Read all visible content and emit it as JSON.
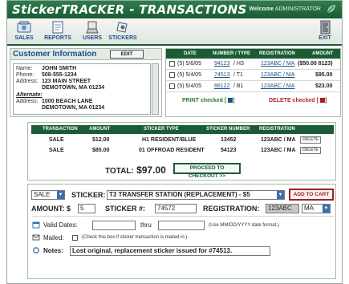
{
  "app": {
    "title": "StickerTRACKER",
    "title_sep": " - ",
    "section": "TRANSACTIONS",
    "welcome_label": "Welcome",
    "user": "ADMINISTRATOR"
  },
  "toolbar": {
    "items": [
      {
        "label": "SALES",
        "icon": "sales-icon"
      },
      {
        "label": "REPORTS",
        "icon": "reports-icon"
      },
      {
        "label": "USERS",
        "icon": "users-icon"
      },
      {
        "label": "STICKERS",
        "icon": "stickers-icon"
      }
    ],
    "exit_label": "EXIT"
  },
  "customer": {
    "heading": "Customer Information",
    "edit_label": "EDIT",
    "name_label": "Name:",
    "name": "JOHN SMITH",
    "phone_label": "Phone:",
    "phone": "508-555-1234",
    "address_label": "Address:",
    "address_line1": "123 MAIN STREET",
    "address_line2": "DEMOTOWN, MA 01234",
    "alternate_label": "Alternate:",
    "alt_address_label": "Address:",
    "alt_line1": "1000 BEACH LANE",
    "alt_line2": "DEMOTOWN, MA 01234"
  },
  "history": {
    "columns": [
      "DATE",
      "NUMBER / TYPE",
      "REGISTRATION",
      "AMOUNT"
    ],
    "rows": [
      {
        "date": "(5) 5/6/05",
        "number": "94123",
        "type": "/ H3",
        "registration": "123ABC / MA",
        "amount": "($50.00 8123)"
      },
      {
        "date": "(5) 5/4/05",
        "number": "74513",
        "type": "/ T1",
        "registration": "123ABC / MA",
        "amount": "$95.00"
      },
      {
        "date": "(5) 5/4/05",
        "number": "86122",
        "type": "/ B1",
        "registration": "123ABC / MA",
        "amount": "$23.00"
      }
    ],
    "print_label": "PRINT checked [",
    "print_suffix": "]",
    "delete_label": "DELETE checked [",
    "delete_suffix": "]"
  },
  "transactions": {
    "columns": [
      "TRANSACTION",
      "AMOUNT",
      "STICKER TYPE",
      "STICKER NUMBER",
      "REGISTRATION"
    ],
    "rows": [
      {
        "transaction": "SALE",
        "amount": "$12.00",
        "sticker_type": "H1 RESIDENT/BLUE",
        "sticker_number": "13452",
        "registration": "123ABC / MA",
        "delete": "DELETE"
      },
      {
        "transaction": "SALE",
        "amount": "$85.00",
        "sticker_type": "01 OFFROAD RESIDENT",
        "sticker_number": "54123",
        "registration": "123ABC / MA",
        "delete": "DELETE"
      }
    ],
    "total_label": "TOTAL:",
    "total_value": "$97.00",
    "checkout_label": "PROCEED TO CHECKOUT >>"
  },
  "entry": {
    "transaction_type": "SALE",
    "sticker_label": "STICKER:",
    "sticker_value": "T3 TRANSFER STATION (REPLACEMENT) - $5",
    "add_to_cart_label": "ADD TO CART",
    "amount_label": "AMOUNT: $",
    "amount_value": "5",
    "sticker_num_label": "STICKER #:",
    "sticker_num_value": "74572",
    "registration_label": "REGISTRATION:",
    "registration_value": "123ABC",
    "state_value": "MA",
    "valid_dates_label": "Valid Dates:",
    "thru_label": "thru",
    "date_format_hint": "(Use MM/DD/YYYY date format.)",
    "mailed_label": "Mailed:",
    "mailed_hint": "(Check this box if sticker transaction is mailed in.)",
    "notes_label": "Notes:",
    "notes_value": "Lost original, replacement sticker issued for #74513."
  },
  "colors": {
    "brand_green": "#1a5c35",
    "link_blue": "#1b4f8a",
    "alert_red": "#a02020"
  }
}
